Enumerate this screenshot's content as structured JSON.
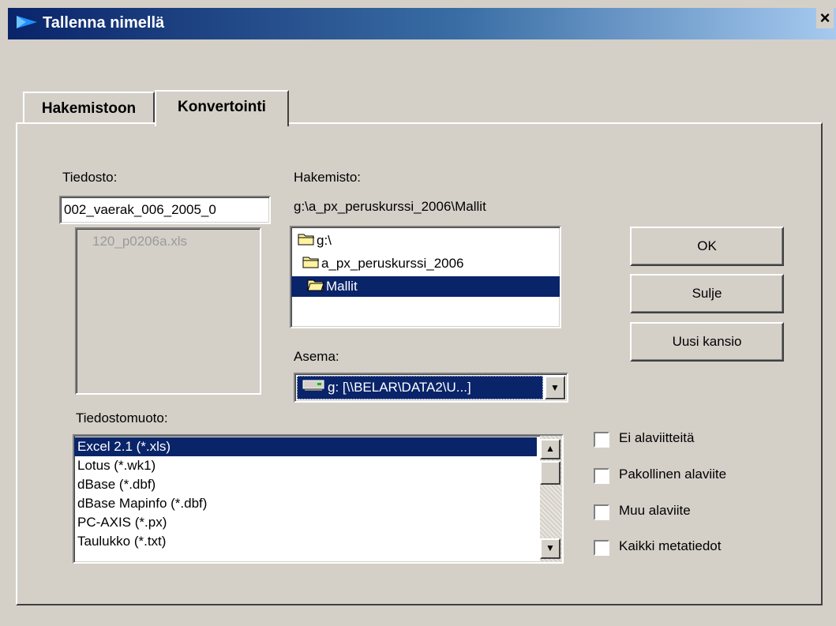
{
  "window": {
    "title": "Tallenna nimellä",
    "close_label": "×"
  },
  "tabs": [
    {
      "label": "Hakemistoon"
    },
    {
      "label": "Konvertointi"
    }
  ],
  "file": {
    "label": "Tiedosto:",
    "value": "002_vaerak_006_2005_0",
    "list": [
      "120_p0206a.xls"
    ]
  },
  "directory": {
    "label": "Hakemisto:",
    "path": "g:\\a_px_peruskurssi_2006\\Mallit",
    "items": [
      "g:\\",
      "a_px_peruskurssi_2006",
      "Mallit"
    ]
  },
  "drive": {
    "label": "Asema:",
    "value": "g: [\\\\BELAR\\DATA2\\U...]"
  },
  "format": {
    "label": "Tiedostomuoto:",
    "items": [
      "Excel 2.1 (*.xls)",
      "Lotus (*.wk1)",
      "dBase (*.dbf)",
      "dBase Mapinfo (*.dbf)",
      "PC-AXIS (*.px)",
      "Taulukko (*.txt)"
    ]
  },
  "buttons": {
    "ok": "OK",
    "close": "Sulje",
    "new_folder": "Uusi kansio"
  },
  "checkboxes": [
    {
      "label": "Ei alaviitteitä",
      "checked": false
    },
    {
      "label": "Pakollinen alaviite",
      "checked": false
    },
    {
      "label": "Muu alaviite",
      "checked": false
    },
    {
      "label": "Kaikki metatiedot",
      "checked": false
    }
  ],
  "colors": {
    "selection": "#0a246a",
    "face": "#d4d0c8",
    "title_start": "#0a246a",
    "title_end": "#a6caf0"
  },
  "icons": [
    "app-icon",
    "close-icon",
    "folder-icon",
    "drive-icon",
    "scroll-up-icon",
    "scroll-down-icon",
    "dropdown-arrow-icon"
  ]
}
